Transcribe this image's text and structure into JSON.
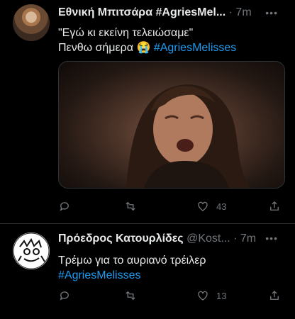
{
  "tweets": [
    {
      "name": "Εθνική Μπιτσάρα #AgriesMel...",
      "time": "7m",
      "line1": "\"Εγώ κι εκείνη τελειώσαμε\"",
      "line2_text": "Πενθω σήμερα 😭 ",
      "line2_tag": "#AgriesMelisses",
      "likes": "43",
      "avatar_icon": "profile-photo"
    },
    {
      "name": "Πρόεδρος Κατουρλίδες",
      "handle": "@Kost...",
      "time": "7m",
      "line1": "Τρέμω για το αυριανό τρέιλερ",
      "line2_tag": "#AgriesMelisses",
      "likes": "13",
      "avatar_icon": "cartoon-avatar"
    }
  ],
  "dot": "·",
  "more": "•••",
  "colors": {
    "background": "#000000",
    "link": "#1d9bf0",
    "muted": "#71767b"
  },
  "icons": [
    "reply-icon",
    "retweet-icon",
    "like-icon",
    "share-icon"
  ]
}
